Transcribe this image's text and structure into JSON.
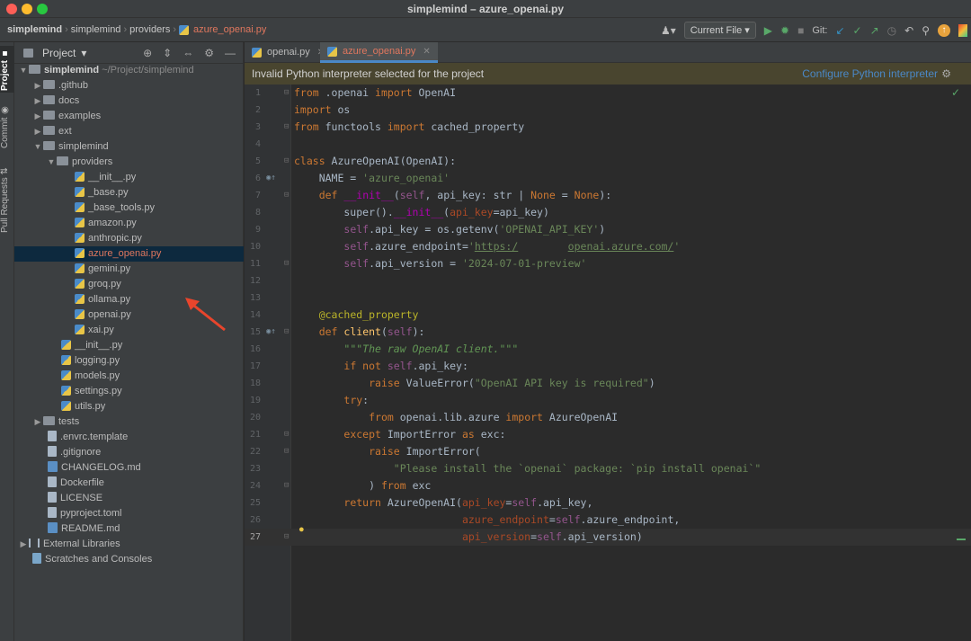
{
  "window": {
    "title": "simplemind – azure_openai.py"
  },
  "breadcrumb": [
    "simplemind",
    "simplemind",
    "providers",
    "azure_openai.py"
  ],
  "toolbar": {
    "run_config": "Current File",
    "git_label": "Git:"
  },
  "project_panel": {
    "title": "Project",
    "root": "simplemind",
    "root_path": "~/Project/simplemind",
    "items": [
      {
        "label": ".github",
        "type": "folder"
      },
      {
        "label": "docs",
        "type": "folder"
      },
      {
        "label": "examples",
        "type": "folder"
      },
      {
        "label": "ext",
        "type": "folder"
      },
      {
        "label": "simplemind",
        "type": "folder-open"
      },
      {
        "label": "providers",
        "type": "folder-open"
      },
      {
        "label": "__init__.py",
        "type": "py"
      },
      {
        "label": "_base.py",
        "type": "py"
      },
      {
        "label": "_base_tools.py",
        "type": "py"
      },
      {
        "label": "amazon.py",
        "type": "py"
      },
      {
        "label": "anthropic.py",
        "type": "py"
      },
      {
        "label": "azure_openai.py",
        "type": "py"
      },
      {
        "label": "gemini.py",
        "type": "py"
      },
      {
        "label": "groq.py",
        "type": "py"
      },
      {
        "label": "ollama.py",
        "type": "py"
      },
      {
        "label": "openai.py",
        "type": "py"
      },
      {
        "label": "xai.py",
        "type": "py"
      },
      {
        "label": "__init__.py",
        "type": "py"
      },
      {
        "label": "logging.py",
        "type": "py"
      },
      {
        "label": "models.py",
        "type": "py"
      },
      {
        "label": "settings.py",
        "type": "py"
      },
      {
        "label": "utils.py",
        "type": "py"
      },
      {
        "label": "tests",
        "type": "folder"
      },
      {
        "label": ".envrc.template",
        "type": "txt"
      },
      {
        "label": ".gitignore",
        "type": "txt"
      },
      {
        "label": "CHANGELOG.md",
        "type": "md"
      },
      {
        "label": "Dockerfile",
        "type": "txt"
      },
      {
        "label": "LICENSE",
        "type": "txt"
      },
      {
        "label": "pyproject.toml",
        "type": "txt"
      },
      {
        "label": "README.md",
        "type": "md"
      },
      {
        "label": "External Libraries",
        "type": "lib"
      },
      {
        "label": "Scratches and Consoles",
        "type": "scratch"
      }
    ]
  },
  "side_tabs": [
    "Project",
    "Commit",
    "Pull Requests"
  ],
  "tabs": [
    {
      "label": "openai.py",
      "active": false
    },
    {
      "label": "azure_openai.py",
      "active": true
    }
  ],
  "banner": {
    "message": "Invalid Python interpreter selected for the project",
    "action": "Configure Python interpreter"
  },
  "editor": {
    "current_line": 27,
    "lines": [
      "from .openai import OpenAI",
      "import os",
      "from functools import cached_property",
      "",
      "class AzureOpenAI(OpenAI):",
      "    NAME = 'azure_openai'",
      "    def __init__(self, api_key: str | None = None):",
      "        super().__init__(api_key=api_key)",
      "        self.api_key = os.getenv('OPENAI_API_KEY')",
      "        self.azure_endpoint='https:/        openai.azure.com/'",
      "        self.api_version = '2024-07-01-preview'",
      "",
      "",
      "    @cached_property",
      "    def client(self):",
      "        \"\"\"The raw OpenAI client.\"\"\"",
      "        if not self.api_key:",
      "            raise ValueError(\"OpenAI API key is required\")",
      "        try:",
      "            from openai.lib.azure import AzureOpenAI",
      "        except ImportError as exc:",
      "            raise ImportError(",
      "                \"Please install the `openai` package: `pip install openai`\"",
      "            ) from exc",
      "        return AzureOpenAI(api_key=self.api_key,",
      "                           azure_endpoint=self.azure_endpoint,",
      "                           api_version=self.api_version)"
    ]
  },
  "colors": {
    "accent": "#4a88c7",
    "warning_bg": "#49452f",
    "selected_row": "#0d293e",
    "arrow": "#e8452c"
  }
}
